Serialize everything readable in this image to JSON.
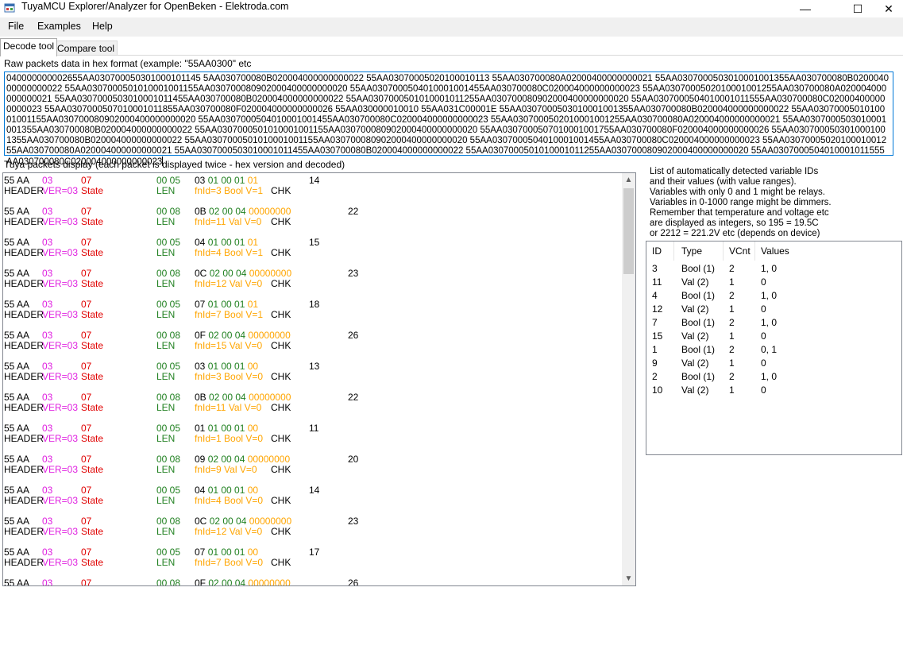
{
  "window": {
    "title": "TuyaMCU Explorer/Analyzer for OpenBeken - Elektroda.com",
    "minimize": "—",
    "maximize": "☐",
    "close": "✕"
  },
  "menu": {
    "file": "File",
    "examples": "Examples",
    "help": "Help"
  },
  "tabs": {
    "decode": "Decode tool",
    "compare": "Compare tool"
  },
  "raw": {
    "label": "Raw packets data in hex format (example: \"55AA0300\" etc",
    "value": "040000000002655AA030700050301000101145 5AA030700080B020004000000000022 55AA03070005020100010113 55AA030700080A02000400000000021 55AA0307000503010001001355AA030700080B020004000000000022 55AA0307000501010001001155AA030700080902000400000000020 55AA0307000504010001001455AA030700080C020004000000000023 55AA0307000502010001001255AA030700080A020004000000000021 55AA0307000503010001011455AA030700080B020004000000000022 55AA0307000501010001011255AA030700080902000400000000020 55AA0307000504010001011555AA030700080C020004000000000023 55AA0307000507010001011855AA030700080F020004000000000026 55AA030000010010 55AA031C00001E 55AA0307000503010001001355AA030700080B020004000000000022 55AA0307000501010001001155AA030700080902000400000000020 55AA0307000504010001001455AA030700080C020004000000000023 55AA0307000502010001001255AA030700080A020004000000000021 55AA0307000503010001001355AA030700080B020004000000000022 55AA0307000501010001001155AA030700080902000400000000020 55AA0307000507010001001755AA030700080F020004000000000026 55AA0307000503010001001355AA030700080B020004000000000022 55AA0307000501010001001155AA030700080902000400000000020 55AA0307000504010001001455AA030700080C020004000000000023 55AA0307000502010001001255AA030700080A020004000000000021 55AA0307000503010001011455AA030700080B020004000000000022 55AA0307000501010001011255AA030700080902000400000000020 55AA0307000504010001011555AA030700080C020004000000000023"
  },
  "packets_label": "Tuya packets display (each packet is displayed twice - hex version and decoded)",
  "packets": [
    {
      "head": "55 AA",
      "ver": "03",
      "cmd": "07",
      "len": "00 05",
      "d1": "03 ",
      "d2": "01 00 01 ",
      "d3": "01",
      "chk": "14",
      "h2": "HEADER",
      "v2": "VER=03",
      "s2": "State",
      "l2": "LEN",
      "dec": "fnId=3 Bool V=1",
      "k2": "CHK"
    },
    {
      "head": "55 AA",
      "ver": "03",
      "cmd": "07",
      "len": "00 08",
      "d1": "0B ",
      "d2": "02 00 04 ",
      "d3": "00000000",
      "chk": "22",
      "h2": "HEADER",
      "v2": "VER=03",
      "s2": "State",
      "l2": "LEN",
      "dec": "fnId=11 Val V=0",
      "k2": "CHK"
    },
    {
      "head": "55 AA",
      "ver": "03",
      "cmd": "07",
      "len": "00 05",
      "d1": "04 ",
      "d2": "01 00 01 ",
      "d3": "01",
      "chk": "15",
      "h2": "HEADER",
      "v2": "VER=03",
      "s2": "State",
      "l2": "LEN",
      "dec": "fnId=4 Bool V=1",
      "k2": "CHK"
    },
    {
      "head": "55 AA",
      "ver": "03",
      "cmd": "07",
      "len": "00 08",
      "d1": "0C ",
      "d2": "02 00 04 ",
      "d3": "00000000",
      "chk": "23",
      "h2": "HEADER",
      "v2": "VER=03",
      "s2": "State",
      "l2": "LEN",
      "dec": "fnId=12 Val V=0",
      "k2": "CHK"
    },
    {
      "head": "55 AA",
      "ver": "03",
      "cmd": "07",
      "len": "00 05",
      "d1": "07 ",
      "d2": "01 00 01 ",
      "d3": "01",
      "chk": "18",
      "h2": "HEADER",
      "v2": "VER=03",
      "s2": "State",
      "l2": "LEN",
      "dec": "fnId=7 Bool V=1",
      "k2": "CHK"
    },
    {
      "head": "55 AA",
      "ver": "03",
      "cmd": "07",
      "len": "00 08",
      "d1": "0F ",
      "d2": "02 00 04 ",
      "d3": "00000000",
      "chk": "26",
      "h2": "HEADER",
      "v2": "VER=03",
      "s2": "State",
      "l2": "LEN",
      "dec": "fnId=15 Val V=0",
      "k2": "CHK"
    },
    {
      "head": "55 AA",
      "ver": "03",
      "cmd": "07",
      "len": "00 05",
      "d1": "03 ",
      "d2": "01 00 01 ",
      "d3": "00",
      "chk": "13",
      "h2": "HEADER",
      "v2": "VER=03",
      "s2": "State",
      "l2": "LEN",
      "dec": "fnId=3 Bool V=0",
      "k2": "CHK"
    },
    {
      "head": "55 AA",
      "ver": "03",
      "cmd": "07",
      "len": "00 08",
      "d1": "0B ",
      "d2": "02 00 04 ",
      "d3": "00000000",
      "chk": "22",
      "h2": "HEADER",
      "v2": "VER=03",
      "s2": "State",
      "l2": "LEN",
      "dec": "fnId=11 Val V=0",
      "k2": "CHK"
    },
    {
      "head": "55 AA",
      "ver": "03",
      "cmd": "07",
      "len": "00 05",
      "d1": "01 ",
      "d2": "01 00 01 ",
      "d3": "00",
      "chk": "11",
      "h2": "HEADER",
      "v2": "VER=03",
      "s2": "State",
      "l2": "LEN",
      "dec": "fnId=1 Bool V=0",
      "k2": "CHK"
    },
    {
      "head": "55 AA",
      "ver": "03",
      "cmd": "07",
      "len": "00 08",
      "d1": "09 ",
      "d2": "02 00 04 ",
      "d3": "00000000",
      "chk": "20",
      "h2": "HEADER",
      "v2": "VER=03",
      "s2": "State",
      "l2": "LEN",
      "dec": "fnId=9 Val V=0",
      "k2": "CHK"
    },
    {
      "head": "55 AA",
      "ver": "03",
      "cmd": "07",
      "len": "00 05",
      "d1": "04 ",
      "d2": "01 00 01 ",
      "d3": "00",
      "chk": "14",
      "h2": "HEADER",
      "v2": "VER=03",
      "s2": "State",
      "l2": "LEN",
      "dec": "fnId=4 Bool V=0",
      "k2": "CHK"
    },
    {
      "head": "55 AA",
      "ver": "03",
      "cmd": "07",
      "len": "00 08",
      "d1": "0C ",
      "d2": "02 00 04 ",
      "d3": "00000000",
      "chk": "23",
      "h2": "HEADER",
      "v2": "VER=03",
      "s2": "State",
      "l2": "LEN",
      "dec": "fnId=12 Val V=0",
      "k2": "CHK"
    },
    {
      "head": "55 AA",
      "ver": "03",
      "cmd": "07",
      "len": "00 05",
      "d1": "07 ",
      "d2": "01 00 01 ",
      "d3": "00",
      "chk": "17",
      "h2": "HEADER",
      "v2": "VER=03",
      "s2": "State",
      "l2": "LEN",
      "dec": "fnId=7 Bool V=0",
      "k2": "CHK"
    },
    {
      "head": "55 AA",
      "ver": "03",
      "cmd": "07",
      "len": "00 08",
      "d1": "0F ",
      "d2": "02 00 04 ",
      "d3": "00000000",
      "chk": "26",
      "h2": "",
      "v2": "",
      "s2": "",
      "l2": "",
      "dec": "",
      "k2": ""
    }
  ],
  "info_lines": [
    "List of automatically detected variable IDs",
    "and their values (with value ranges).",
    "Variables with only 0 and 1 might be relays.",
    "Variables in 0-1000 range might be dimmers.",
    "Remember that temperature and voltage etc",
    "are displayed as integers, so 195 = 19.5C",
    "or 2212 = 221.2V etc (depends on device)"
  ],
  "vars": {
    "headers": {
      "id": "ID",
      "type": "Type",
      "vcnt": "VCnt",
      "values": "Values"
    },
    "rows": [
      {
        "id": "3",
        "type": "Bool (1)",
        "vcnt": "2",
        "values": "1, 0"
      },
      {
        "id": "11",
        "type": "Val (2)",
        "vcnt": "1",
        "values": "0"
      },
      {
        "id": "4",
        "type": "Bool (1)",
        "vcnt": "2",
        "values": "1, 0"
      },
      {
        "id": "12",
        "type": "Val (2)",
        "vcnt": "1",
        "values": "0"
      },
      {
        "id": "7",
        "type": "Bool (1)",
        "vcnt": "2",
        "values": "1, 0"
      },
      {
        "id": "15",
        "type": "Val (2)",
        "vcnt": "1",
        "values": "0"
      },
      {
        "id": "1",
        "type": "Bool (1)",
        "vcnt": "2",
        "values": "0, 1"
      },
      {
        "id": "9",
        "type": "Val (2)",
        "vcnt": "1",
        "values": "0"
      },
      {
        "id": "2",
        "type": "Bool (1)",
        "vcnt": "2",
        "values": "1, 0"
      },
      {
        "id": "10",
        "type": "Val (2)",
        "vcnt": "1",
        "values": "0"
      }
    ]
  },
  "icons": {
    "app": "app-icon",
    "scroll_up": "chevron-up-icon",
    "scroll_down": "chevron-down-icon"
  }
}
